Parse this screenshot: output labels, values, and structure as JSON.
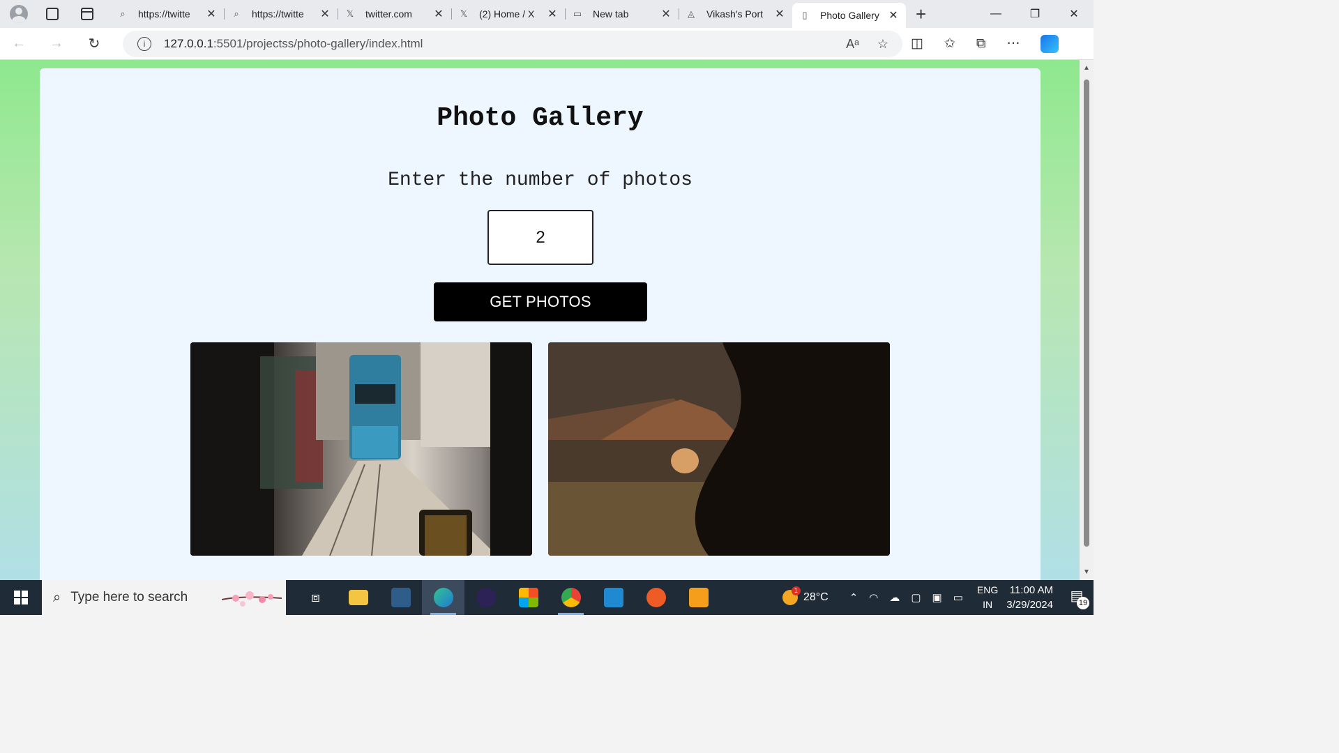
{
  "browser": {
    "tabs": [
      {
        "title": "https://twitte",
        "icon": "search-icon"
      },
      {
        "title": "https://twitte",
        "icon": "search-icon"
      },
      {
        "title": "twitter.com",
        "icon": "x-logo-icon"
      },
      {
        "title": "(2) Home / X",
        "icon": "x-logo-icon"
      },
      {
        "title": "New tab",
        "icon": "newtab-icon"
      },
      {
        "title": "Vikash's Port",
        "icon": "fox-icon"
      },
      {
        "title": "Photo Gallery",
        "icon": "page-icon",
        "active": true
      }
    ],
    "url_host": "127.0.0.1",
    "url_path": ":5501/projectss/photo-gallery/index.html"
  },
  "page": {
    "title": "Photo Gallery",
    "prompt": "Enter the number of photos",
    "input_value": "2",
    "button_label": "GET PHOTOS",
    "photos": [
      {
        "subject": "tram-on-city-street-photo"
      },
      {
        "subject": "mountain-landscape-photo"
      }
    ]
  },
  "taskbar": {
    "search_placeholder": "Type here to search",
    "weather_temp": "28°C",
    "weather_badge": "1",
    "lang_line1": "ENG",
    "lang_line2": "IN",
    "time": "11:00 AM",
    "date": "3/29/2024",
    "notification_count": "19"
  },
  "colors": {
    "bg_gradient_top": "#8ee88e",
    "bg_gradient_bottom": "#b1dfe6",
    "card_bg": "#eef6ff",
    "button_bg": "#000000",
    "taskbar_bg": "#202b38"
  }
}
